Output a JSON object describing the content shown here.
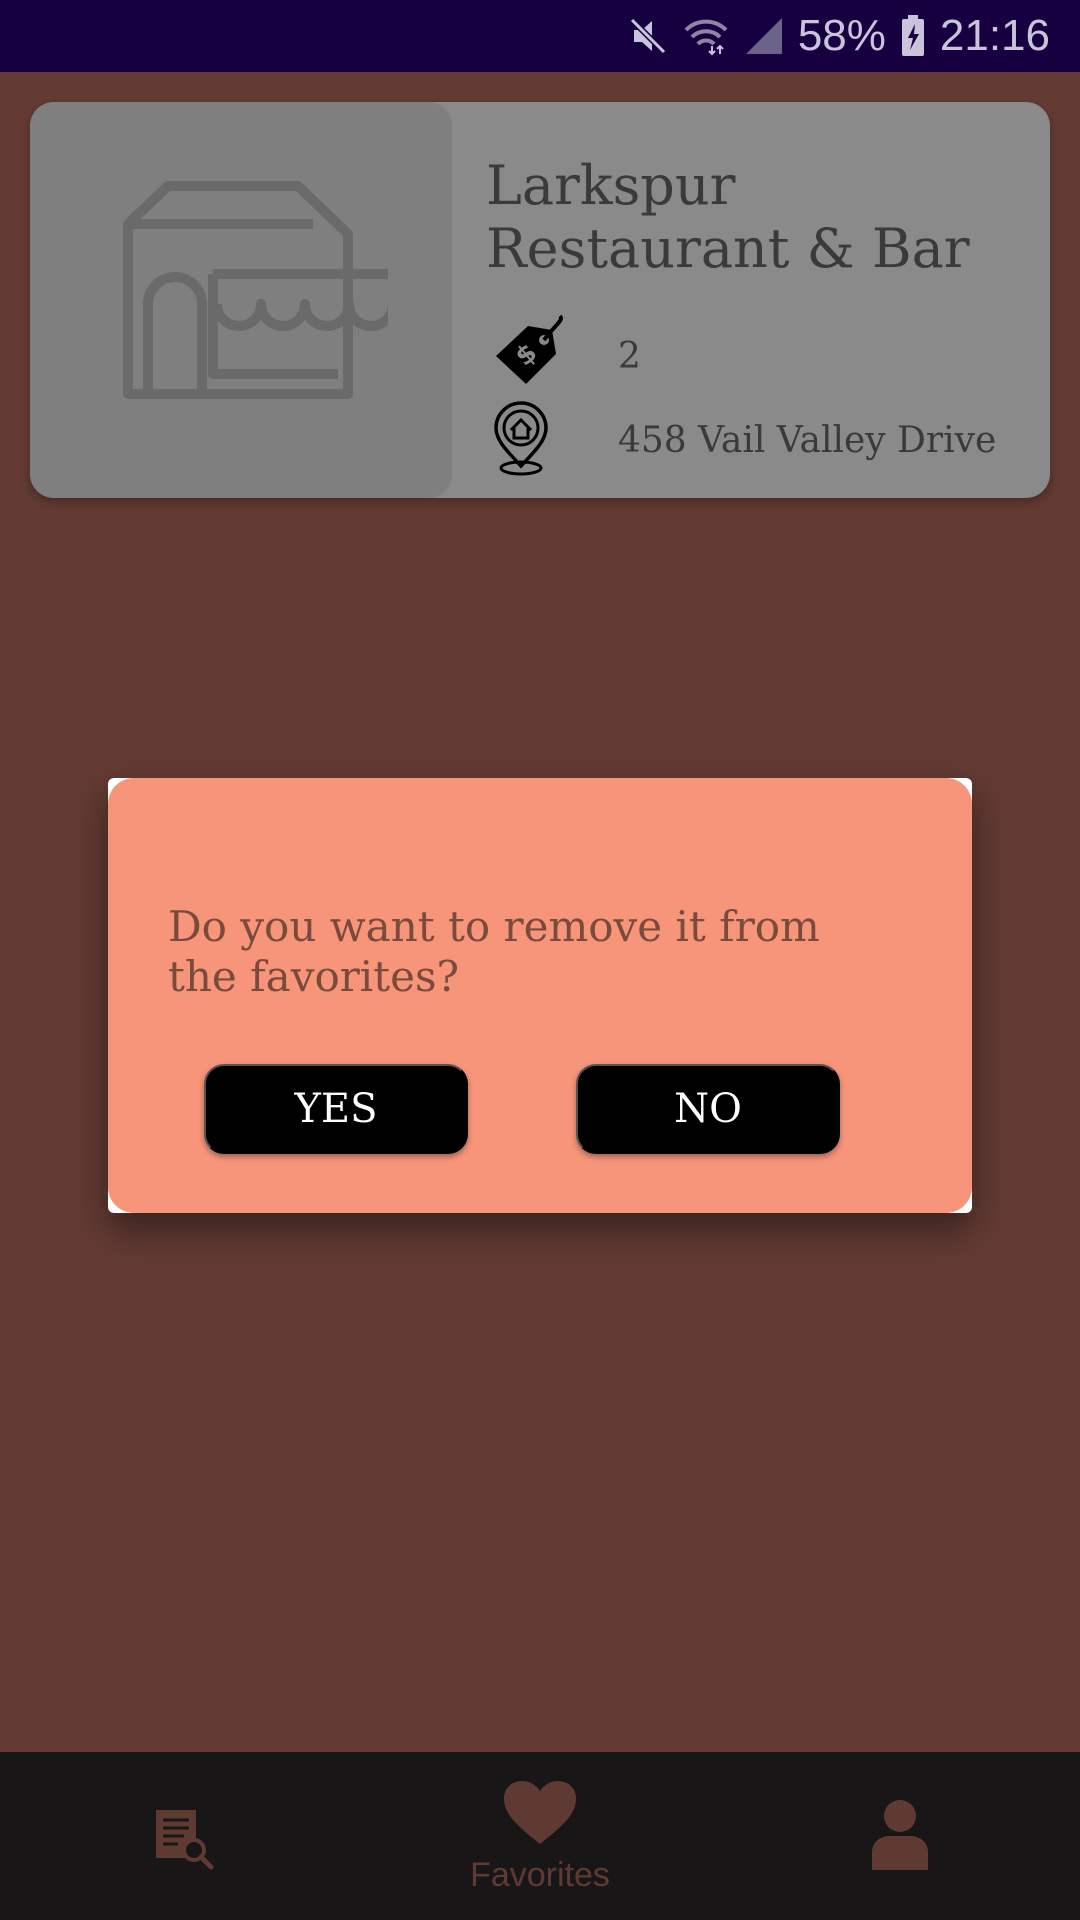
{
  "status_bar": {
    "battery": "58%",
    "time": "21:16",
    "icons": [
      "mute-icon",
      "wifi-icon",
      "signal-icon",
      "battery-charging-icon"
    ]
  },
  "favorites": [
    {
      "name": "Larkspur Restaurant & Bar",
      "price_level": "2",
      "address": "458 Vail Valley Drive",
      "icons": [
        "store-icon",
        "price-tag-icon",
        "location-pin-icon"
      ]
    }
  ],
  "dialog": {
    "message": "Do you want to remove it from the favorites?",
    "yes_label": "YES",
    "no_label": "NO"
  },
  "bottom_nav": {
    "items": [
      {
        "icon": "search-list-icon",
        "label": ""
      },
      {
        "icon": "heart-icon",
        "label": "Favorites",
        "active": true
      },
      {
        "icon": "user-icon",
        "label": ""
      }
    ]
  },
  "colors": {
    "status_bar": "#16003f",
    "background": "#633b33",
    "dialog": "#f6957a",
    "button": "#000000",
    "nav": "#181617",
    "nav_active": "#5e3a32"
  }
}
